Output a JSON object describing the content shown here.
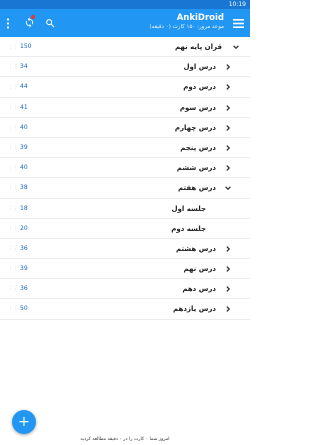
{
  "status_bar": {
    "time": "10:19"
  },
  "app_bar": {
    "title": "AnkiDroid",
    "subtitle": "موعد مرور: ۱۵۰ کارت (۰ دقیقه)",
    "sync_badge": true,
    "menu_icon": "hamburger-menu-icon",
    "search_icon": "search-icon",
    "sync_icon": "sync-icon",
    "overflow_icon": "more-vert-icon"
  },
  "decks": [
    {
      "name": "قران پایه نهم",
      "count": "150",
      "level": "top",
      "expanded": true
    },
    {
      "name": "درس اول",
      "count": "34",
      "level": "sub",
      "expanded": false
    },
    {
      "name": "درس دوم",
      "count": "44",
      "level": "sub",
      "expanded": false
    },
    {
      "name": "درس سوم",
      "count": "41",
      "level": "sub",
      "expanded": false
    },
    {
      "name": "درس چهارم",
      "count": "40",
      "level": "sub",
      "expanded": false
    },
    {
      "name": "درس پنجم",
      "count": "39",
      "level": "sub",
      "expanded": false
    },
    {
      "name": "درس ششم",
      "count": "40",
      "level": "sub",
      "expanded": false
    },
    {
      "name": "درس هفتم",
      "count": "38",
      "level": "sub",
      "expanded": true
    },
    {
      "name": "جلسه اول",
      "count": "18",
      "level": "subsub"
    },
    {
      "name": "جلسه دوم",
      "count": "20",
      "level": "subsub"
    },
    {
      "name": "درس هشتم",
      "count": "36",
      "level": "sub",
      "expanded": false
    },
    {
      "name": "درس نهم",
      "count": "39",
      "level": "sub",
      "expanded": false
    },
    {
      "name": "درس دهم",
      "count": "36",
      "level": "sub",
      "expanded": false
    },
    {
      "name": "درس یازدهم",
      "count": "50",
      "level": "sub",
      "expanded": false
    }
  ],
  "fab": {
    "label": "+",
    "icon": "add-icon"
  },
  "footer": {
    "text": "امروز شما ۰ کارت را در ۰ دقیقه مطالعه کردید"
  },
  "colors": {
    "primary": "#2196f3",
    "primary_dark": "#1976d2",
    "count": "#1565c0",
    "badge": "#e53935"
  }
}
